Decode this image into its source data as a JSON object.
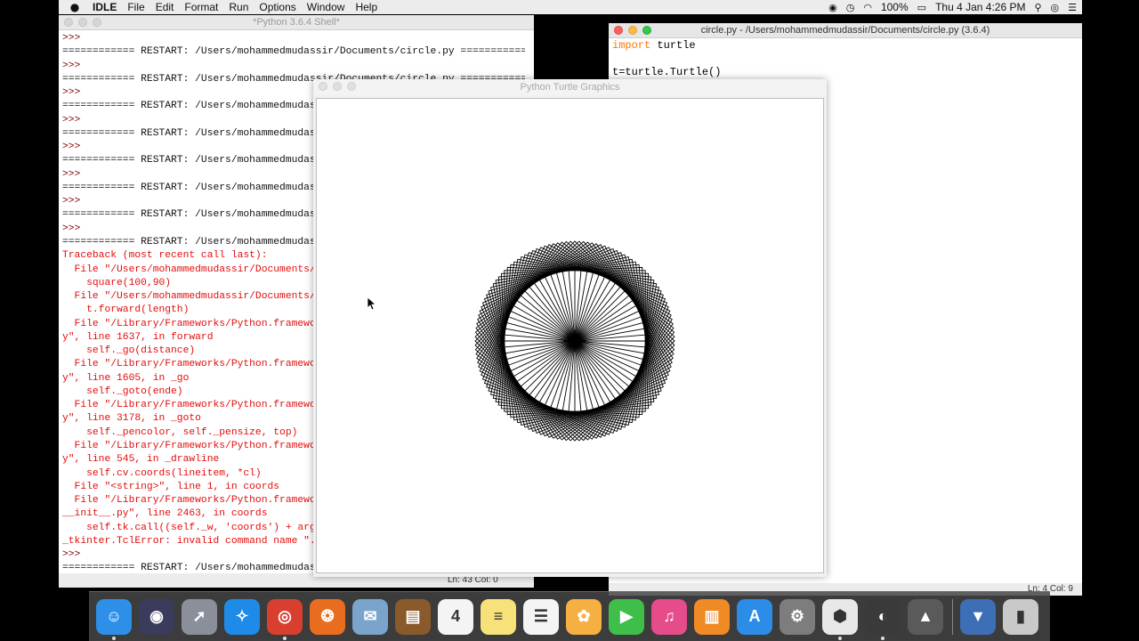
{
  "menubar": {
    "apple": "",
    "app_name": "IDLE",
    "items": [
      "File",
      "Edit",
      "Format",
      "Run",
      "Options",
      "Window",
      "Help"
    ],
    "battery": "100%",
    "clock": "Thu 4 Jan  4:26 PM"
  },
  "shell": {
    "title": "*Python 3.6.4 Shell*",
    "lines": [
      {
        "t": ">>>",
        "k": "prompt"
      },
      {
        "t": "============ RESTART: /Users/mohammedmudassir/Documents/circle.py ============",
        "k": "out"
      },
      {
        "t": ">>>",
        "k": "prompt"
      },
      {
        "t": "============ RESTART: /Users/mohammedmudassir/Documents/circle.py ============",
        "k": "out"
      },
      {
        "t": ">>>",
        "k": "prompt"
      },
      {
        "t": "============ RESTART: /Users/mohammedmudassi",
        "k": "out"
      },
      {
        "t": ">>>",
        "k": "prompt"
      },
      {
        "t": "============ RESTART: /Users/mohammedmudassi",
        "k": "out"
      },
      {
        "t": ">>>",
        "k": "prompt"
      },
      {
        "t": "============ RESTART: /Users/mohammedmudassi",
        "k": "out"
      },
      {
        "t": ">>>",
        "k": "prompt"
      },
      {
        "t": "============ RESTART: /Users/mohammedmudassi",
        "k": "out"
      },
      {
        "t": ">>>",
        "k": "prompt"
      },
      {
        "t": "============ RESTART: /Users/mohammedmudassi",
        "k": "out"
      },
      {
        "t": ">>>",
        "k": "prompt"
      },
      {
        "t": "============ RESTART: /Users/mohammedmudassi",
        "k": "out"
      },
      {
        "t": "Traceback (most recent call last):",
        "k": "err"
      },
      {
        "t": "  File \"/Users/mohammedmudassir/Documents/ci",
        "k": "err"
      },
      {
        "t": "    square(100,90)",
        "k": "err"
      },
      {
        "t": "  File \"/Users/mohammedmudassir/Documents/ci",
        "k": "err"
      },
      {
        "t": "    t.forward(length)",
        "k": "err"
      },
      {
        "t": "  File \"/Library/Frameworks/Python.framework",
        "k": "err"
      },
      {
        "t": "y\", line 1637, in forward",
        "k": "err"
      },
      {
        "t": "    self._go(distance)",
        "k": "err"
      },
      {
        "t": "  File \"/Library/Frameworks/Python.framework",
        "k": "err"
      },
      {
        "t": "y\", line 1605, in _go",
        "k": "err"
      },
      {
        "t": "    self._goto(ende)",
        "k": "err"
      },
      {
        "t": "  File \"/Library/Frameworks/Python.framework",
        "k": "err"
      },
      {
        "t": "y\", line 3178, in _goto",
        "k": "err"
      },
      {
        "t": "    self._pencolor, self._pensize, top)",
        "k": "err"
      },
      {
        "t": "  File \"/Library/Frameworks/Python.framework",
        "k": "err"
      },
      {
        "t": "y\", line 545, in _drawline",
        "k": "err"
      },
      {
        "t": "    self.cv.coords(lineitem, *cl)",
        "k": "err"
      },
      {
        "t": "  File \"<string>\", line 1, in coords",
        "k": "err"
      },
      {
        "t": "  File \"/Library/Frameworks/Python.framework",
        "k": "err"
      },
      {
        "t": "__init__.py\", line 2463, in coords",
        "k": "err"
      },
      {
        "t": "    self.tk.call((self._w, 'coords') + args)",
        "k": "err"
      },
      {
        "t": "_tkinter.TclError: invalid command name \".!c",
        "k": "err"
      },
      {
        "t": ">>>",
        "k": "prompt"
      },
      {
        "t": "============ RESTART: /Users/mohammedmudassi",
        "k": "out"
      }
    ],
    "status": "Ln: 43  Col: 0"
  },
  "editor": {
    "title": "circle.py - /Users/mohammedmudassir/Documents/circle.py (3.6.4)",
    "code_kw": "import",
    "code_line1_rest": " turtle",
    "code_line3": "t=turtle.Turtle()",
    "status": "Ln: 4   Col: 9"
  },
  "turtle": {
    "title": "Python Turtle Graphics",
    "pattern_lines": 36
  },
  "dock": {
    "apps": [
      {
        "name": "finder-icon",
        "color": "#2d8fe8",
        "glyph": "☺"
      },
      {
        "name": "siri-icon",
        "color": "#3b3b5c",
        "glyph": "◉"
      },
      {
        "name": "launchpad-icon",
        "color": "#8a8f99",
        "glyph": "➚"
      },
      {
        "name": "safari-icon",
        "color": "#1f8be8",
        "glyph": "✧"
      },
      {
        "name": "chrome-icon",
        "color": "#d93f2f",
        "glyph": "◎"
      },
      {
        "name": "firefox-icon",
        "color": "#e86d1f",
        "glyph": "❂"
      },
      {
        "name": "preview-icon",
        "color": "#7aa4cc",
        "glyph": "✉"
      },
      {
        "name": "notebook-icon",
        "color": "#8a5a2b",
        "glyph": "▤"
      },
      {
        "name": "calendar-icon",
        "color": "#f4f4f4",
        "glyph": "4"
      },
      {
        "name": "notes-icon",
        "color": "#f7e27a",
        "glyph": "≡"
      },
      {
        "name": "reminders-icon",
        "color": "#f4f4f4",
        "glyph": "☰"
      },
      {
        "name": "photos-icon",
        "color": "#f5b041",
        "glyph": "✿"
      },
      {
        "name": "facetime-icon",
        "color": "#3fbf4a",
        "glyph": "▶"
      },
      {
        "name": "itunes-icon",
        "color": "#e64b8a",
        "glyph": "♫"
      },
      {
        "name": "ibooks-icon",
        "color": "#f08a24",
        "glyph": "▥"
      },
      {
        "name": "app-store-icon",
        "color": "#2b8de8",
        "glyph": "A"
      },
      {
        "name": "system-preferences-icon",
        "color": "#7d7d7d",
        "glyph": "⚙"
      },
      {
        "name": "python-launcher-icon",
        "color": "#e8e8e8",
        "glyph": "⬢"
      },
      {
        "name": "quicktime-icon",
        "color": "#3a3a3a",
        "glyph": "◐"
      },
      {
        "name": "rocket-icon",
        "color": "#5a5a5a",
        "glyph": "▲"
      }
    ],
    "right": [
      {
        "name": "downloads-stack-icon",
        "color": "#3c6fb5",
        "glyph": "▼"
      },
      {
        "name": "trash-icon",
        "color": "#c9c9c9",
        "glyph": "▮"
      }
    ]
  }
}
